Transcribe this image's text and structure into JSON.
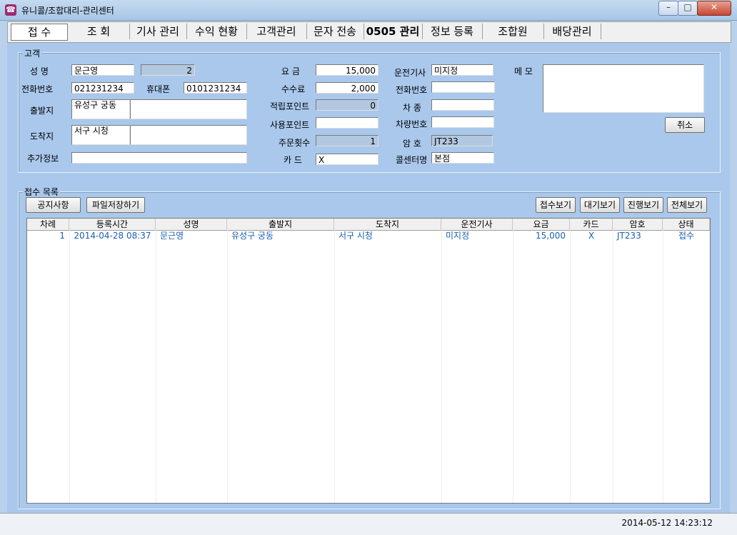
{
  "window": {
    "title": "유니콜/조합대리-관리센터",
    "minimize": "–",
    "maximize": "□",
    "close": "✕"
  },
  "menu": {
    "items": [
      {
        "label": "접  수",
        "active": true
      },
      {
        "label": "조  회"
      },
      {
        "label": "기사 관리"
      },
      {
        "label": "수익 현황"
      },
      {
        "label": "고객관리"
      },
      {
        "label": "문자 전송"
      },
      {
        "label": "0505 관리",
        "bold": true
      },
      {
        "label": "정보 등록"
      },
      {
        "label": "조합원"
      },
      {
        "label": "배당관리"
      }
    ]
  },
  "customer": {
    "legend": "고객",
    "name_label": "성  명",
    "name_value": "문근영",
    "count_value": "2",
    "phone_label": "전화번호",
    "phone_value": "021231234",
    "mobile_label": "휴대폰",
    "mobile_value": "0101231234",
    "origin_label": "출발지",
    "origin_value": "유성구 궁동",
    "origin_detail": "",
    "dest_label": "도착지",
    "dest_value": "서구 시청",
    "dest_detail": "",
    "extra_label": "추가정보",
    "extra_value": "",
    "fare_label": "요  금",
    "fare_value": "15,000",
    "fee_label": "수수료",
    "fee_value": "2,000",
    "points_label": "적립포인트",
    "points_value": "0",
    "use_points_label": "사용포인트",
    "use_points_value": "",
    "orders_label": "주문횟수",
    "orders_value": "1",
    "card_label": "카  드",
    "card_value": "X",
    "driver_label": "운전기사",
    "driver_value": "미지정",
    "driver_phone_label": "전화번호",
    "driver_phone_value": "",
    "car_type_label": "차  종",
    "car_type_value": "",
    "car_no_label": "차량번호",
    "car_no_value": "",
    "code_label": "암  호",
    "code_value": "JT233",
    "callcenter_label": "콜센터명",
    "callcenter_value": "본점",
    "memo_label": "메  모",
    "memo_value": "",
    "cancel_button": "취소"
  },
  "list": {
    "legend": "접수 목록",
    "notice_button": "공지사항",
    "save_file_button": "파일저장하기",
    "view_received": "접수보기",
    "view_waiting": "대기보기",
    "view_progress": "진행보기",
    "view_all": "전체보기",
    "columns": [
      "차례",
      "등록시간",
      "성명",
      "출발지",
      "도착지",
      "운전기사",
      "요금",
      "카드",
      "암호",
      "상태"
    ],
    "rows": [
      [
        "1",
        "2014-04-28 08:37",
        "문근영",
        "유성구 궁동",
        "서구 시청",
        "미지정",
        "15,000",
        "X",
        "JT233",
        "접수"
      ]
    ]
  },
  "status": {
    "datetime": "2014-05-12 14:23:12"
  }
}
